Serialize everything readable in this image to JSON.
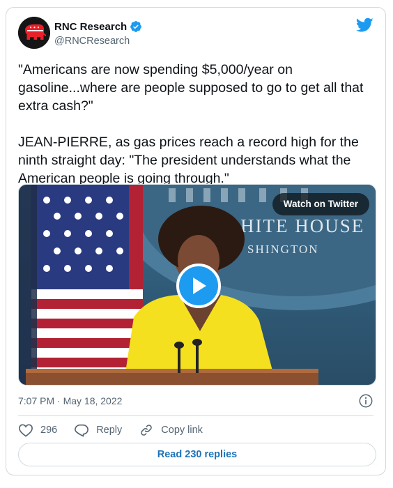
{
  "author": {
    "display_name": "RNC Research",
    "handle": "@RNCResearch",
    "verified": true,
    "avatar_icon": "gop-elephant-logo"
  },
  "platform_icon": "twitter-bird-icon",
  "tweet_text": "\"Americans are now spending $5,000/year on gasoline...where are people supposed to go to get all that extra cash?\"\n\nJEAN-PIERRE, as gas prices reach a record high for the ninth straight day: \"The president understands what the American people is going through.\"",
  "media": {
    "watch_label": "Watch on Twitter",
    "backdrop_lines": [
      "HITE HOUSE",
      "SHINGTON"
    ],
    "play_icon": "play-icon"
  },
  "timestamp": "7:07 PM · May 18, 2022",
  "actions": {
    "like_count": "296",
    "reply_label": "Reply",
    "copy_label": "Copy link"
  },
  "read_replies_label": "Read 230 replies",
  "colors": {
    "accent": "#1d9bf0",
    "link": "#1d73b9",
    "muted": "#536471",
    "border": "#cfd9de",
    "gop_red": "#e8202a"
  }
}
